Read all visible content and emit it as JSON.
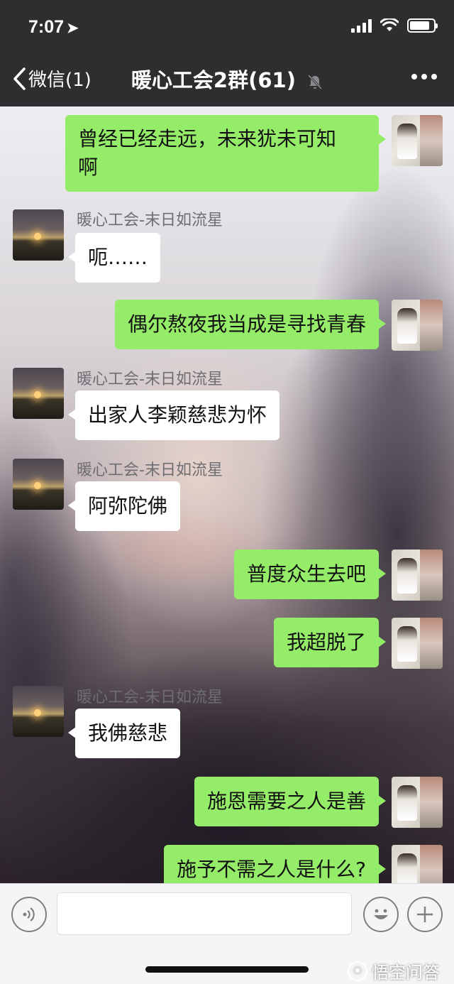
{
  "status_bar": {
    "time": "7:07",
    "location_glyph": "➤",
    "battery_percent": 85
  },
  "header": {
    "back_label": "微信(1)",
    "title": "暖心工会2群(61)"
  },
  "messages": [
    {
      "side": "out",
      "text_lines": [
        "曾经已经走远，未来犹未可知",
        "啊"
      ]
    },
    {
      "side": "in",
      "sender": "暖心工会-末日如流星",
      "text": "呃……"
    },
    {
      "side": "out",
      "text": "偶尔熬夜我当成是寻找青春"
    },
    {
      "side": "in",
      "sender": "暖心工会-末日如流星",
      "text": "出家人李颖慈悲为怀"
    },
    {
      "side": "in",
      "sender": "暖心工会-末日如流星",
      "text": "阿弥陀佛"
    },
    {
      "side": "out",
      "text": "普度众生去吧"
    },
    {
      "side": "out",
      "text": "我超脱了"
    },
    {
      "side": "in",
      "sender": "暖心工会-末日如流星",
      "text": "我佛慈悲"
    },
    {
      "side": "out",
      "text": "施恩需要之人是善"
    },
    {
      "side": "out",
      "text": "施予不需之人是什么?"
    }
  ],
  "input": {
    "value": ""
  },
  "watermark": {
    "text": "悟空问答"
  },
  "colors": {
    "outgoing_bubble": "#95ec69",
    "incoming_bubble": "#ffffff",
    "header_bg": "#2e2e30"
  }
}
